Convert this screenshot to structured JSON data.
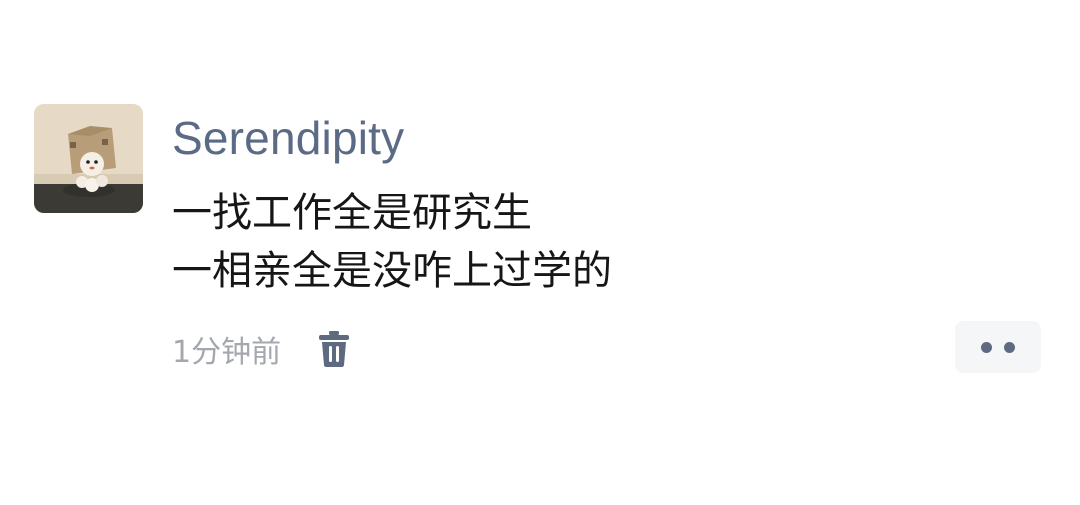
{
  "post": {
    "author": "Serendipity",
    "content_lines": [
      "一找工作全是研究生",
      "一相亲全是没咋上过学的"
    ],
    "timestamp": "1分钟前",
    "icons": {
      "avatar": "avatar-image",
      "delete": "trash-icon",
      "more": "more-dots-icon"
    }
  },
  "colors": {
    "author_name": "#5c6b85",
    "content_text": "#161616",
    "timestamp": "#a4a7ad",
    "icon": "#5d6a80",
    "more_button_bg": "#f5f6f8"
  }
}
